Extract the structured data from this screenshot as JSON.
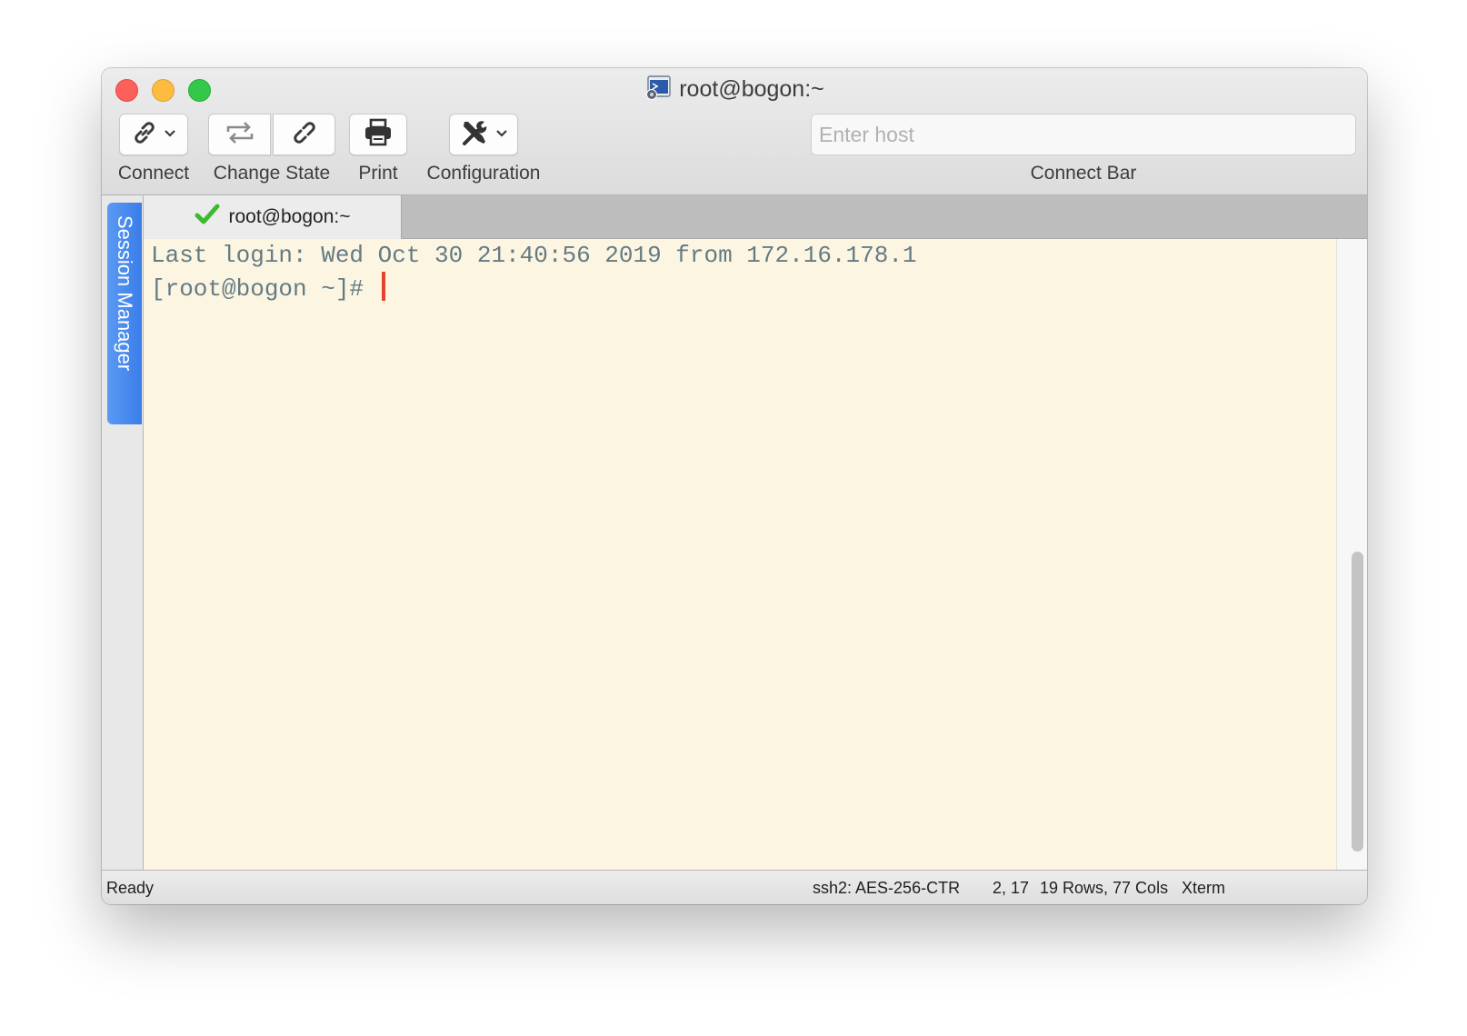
{
  "window": {
    "title": "root@bogon:~"
  },
  "toolbar": {
    "connect_label": "Connect",
    "change_state_label": "Change State",
    "print_label": "Print",
    "configuration_label": "Configuration",
    "connect_bar_label": "Connect Bar",
    "host_placeholder": "Enter host",
    "host_value": ""
  },
  "sidebar": {
    "session_manager_label": "Session Manager"
  },
  "tabs": [
    {
      "label": "root@bogon:~",
      "status_icon": "check-icon",
      "active": true
    }
  ],
  "terminal": {
    "lines": [
      "Last login: Wed Oct 30 21:40:56 2019 from 172.16.178.1",
      "[root@bogon ~]# "
    ]
  },
  "status": {
    "state": "Ready",
    "cipher": "ssh2: AES-256-CTR",
    "cursor_pos": "2, 17",
    "dimensions": "19 Rows, 77 Cols",
    "emulation": "Xterm"
  },
  "colors": {
    "terminal_bg": "#fcf5e2",
    "terminal_fg": "#647b83",
    "cursor": "#e8412e",
    "session_tab": "#4a8cf0",
    "tab_check": "#3dbb2f"
  }
}
